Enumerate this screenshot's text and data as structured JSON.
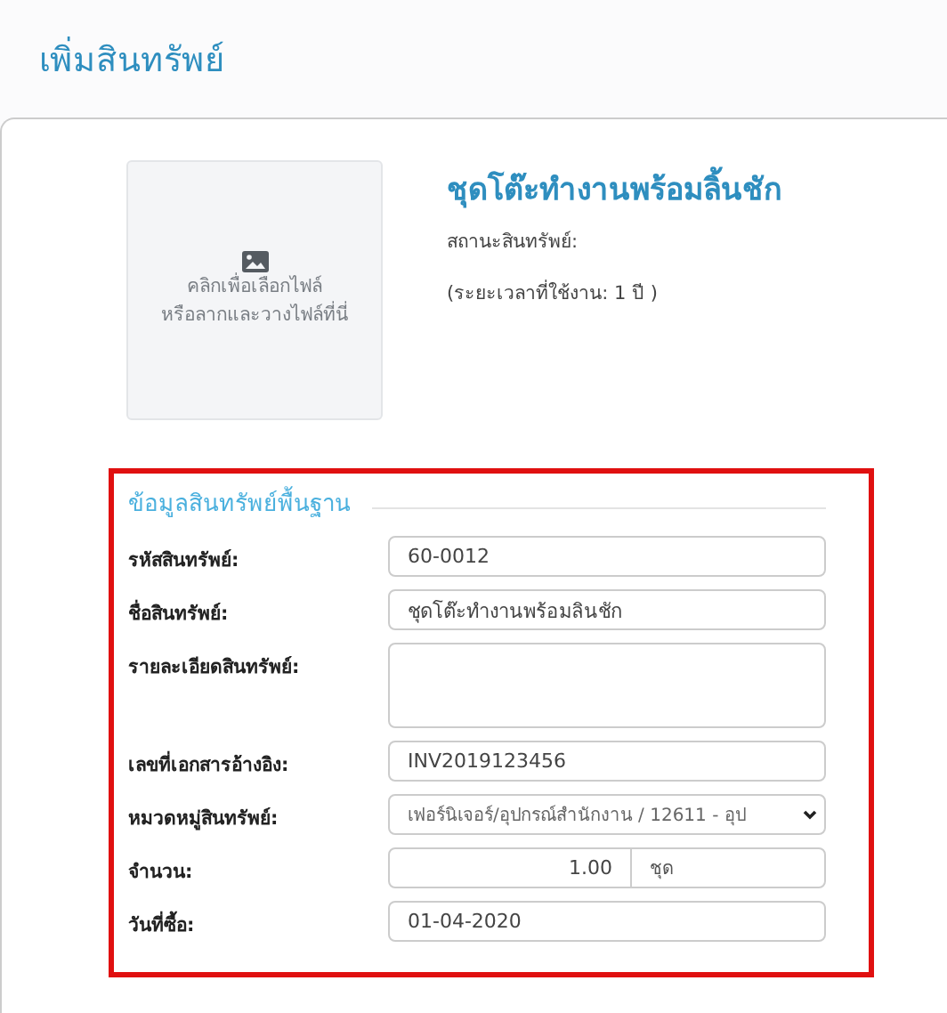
{
  "page_title": "เพิ่มสินทรัพย์",
  "upload": {
    "text_lines": [
      "คลิกเพื่อเลือกไฟล์",
      "หรือลากและวางไฟล์ที่นี่"
    ]
  },
  "asset": {
    "name": "ชุดโต๊ะทำงานพร้อมลิ้นชัก",
    "status_label": "สถานะสินทรัพย์:",
    "usage_period": "(ระยะเวลาที่ใช้งาน: 1 ปี )"
  },
  "section": {
    "title": "ข้อมูลสินทรัพย์พื้นฐาน",
    "fields": [
      {
        "kind": "text",
        "label": "รหัสสินทรัพย์:",
        "value": "60-0012"
      },
      {
        "kind": "text",
        "label": "ชื่อสินทรัพย์:",
        "value": "ชุดโต๊ะทำงานพร้อมลินชัก"
      },
      {
        "kind": "textarea",
        "label": "รายละเอียดสินทรัพย์:"
      },
      {
        "kind": "text",
        "label": "เลขที่เอกสารอ้างอิง:",
        "value": "INV2019123456"
      },
      {
        "kind": "select",
        "label": "หมวดหมู่สินทรัพย์:",
        "value": "เฟอร์นิเจอร์/อุปกรณ์สำนักงาน / 12611 - อุป"
      },
      {
        "kind": "unit",
        "label": "จำนวน:",
        "value": "1.00",
        "unit": "ชุด"
      },
      {
        "kind": "text",
        "label": "วันที่ซื้อ:",
        "value": "01-04-2020"
      }
    ]
  }
}
